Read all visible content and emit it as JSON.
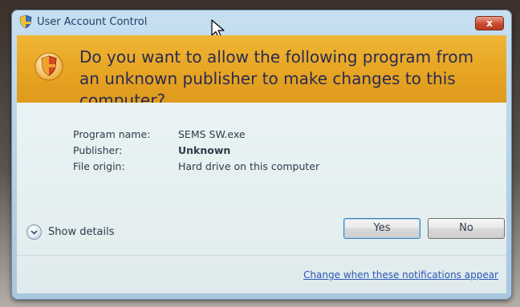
{
  "window": {
    "title": "User Account Control",
    "close_label": "x"
  },
  "banner": {
    "question": "Do you want to allow the following program from an unknown publisher to make changes to this computer?"
  },
  "details": {
    "rows": [
      {
        "label": "Program name:",
        "value": "SEMS SW.exe"
      },
      {
        "label": "Publisher:",
        "value": "Unknown"
      },
      {
        "label": "File origin:",
        "value": "Hard drive on this computer"
      }
    ]
  },
  "footer": {
    "show_details_label": "Show details",
    "yes_label": "Yes",
    "no_label": "No",
    "change_link": "Change when these notifications appear"
  },
  "icons": {
    "title": "shield-icon",
    "banner": "shield-icon",
    "expand": "chevron-down-icon",
    "cursor": "cursor-icon"
  },
  "colors": {
    "banner": "#e7a623",
    "link": "#2c57b6",
    "close": "#c94a2d"
  }
}
